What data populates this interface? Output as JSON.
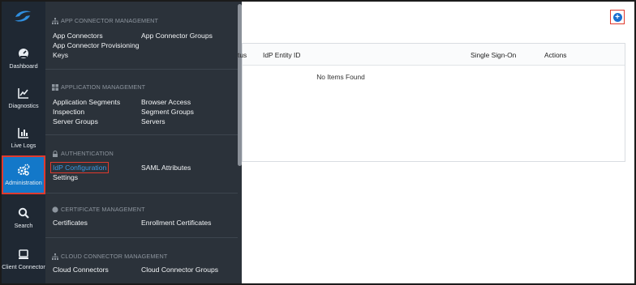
{
  "nav": {
    "items": [
      {
        "label": "Dashboard",
        "icon": "gauge-icon"
      },
      {
        "label": "Diagnostics",
        "icon": "chart-line-icon"
      },
      {
        "label": "Live Logs",
        "icon": "bar-chart-icon"
      },
      {
        "label": "Administration",
        "icon": "gears-icon",
        "active": true
      },
      {
        "label": "Search",
        "icon": "search-icon"
      },
      {
        "label": "Client Connector",
        "icon": "laptop-icon"
      }
    ]
  },
  "menu": {
    "app_connector": {
      "title": "APP CONNECTOR MANAGEMENT",
      "links": [
        "App Connectors",
        "App Connector Groups",
        "App Connector Provisioning",
        "Keys"
      ]
    },
    "application": {
      "title": "APPLICATION MANAGEMENT",
      "links": [
        "Application Segments",
        "Browser Access",
        "Inspection",
        "Segment Groups",
        "Server Groups",
        "Servers"
      ]
    },
    "authentication": {
      "title": "AUTHENTICATION",
      "links": [
        "IdP Configuration",
        "SAML Attributes",
        "Settings"
      ]
    },
    "certificate": {
      "title": "CERTIFICATE MANAGEMENT",
      "links": [
        "Certificates",
        "Enrollment Certificates"
      ]
    },
    "cloud_connector": {
      "title": "CLOUD CONNECTOR MANAGEMENT",
      "links": [
        "Cloud Connectors",
        "Cloud Connector Groups"
      ]
    }
  },
  "table": {
    "columns": [
      "tus",
      "IdP Entity ID",
      "Single Sign-On",
      "Actions"
    ],
    "empty_text": "No Items Found"
  },
  "colors": {
    "rail_bg": "#1f2833",
    "flyout_bg": "#2b323a",
    "accent": "#1378c9",
    "highlight_border": "#e03a2e"
  }
}
